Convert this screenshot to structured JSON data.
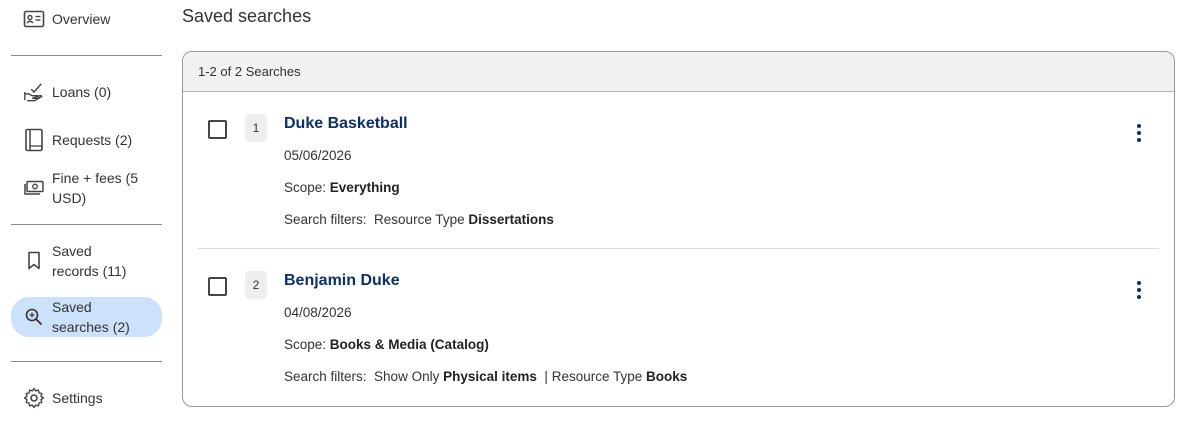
{
  "sidebar": {
    "items": [
      {
        "key": "overview",
        "label": "Overview",
        "icon": "id-card-icon",
        "active": false
      },
      {
        "key": "loans",
        "label": "Loans (0)",
        "icon": "hand-check-icon",
        "active": false
      },
      {
        "key": "requests",
        "label": "Requests (2)",
        "icon": "book-icon",
        "active": false
      },
      {
        "key": "fines",
        "label": "Fine + fees (5 USD)",
        "icon": "money-icon",
        "active": false
      },
      {
        "key": "saved-records",
        "label": "Saved records (11)",
        "icon": "bookmark-icon",
        "active": false
      },
      {
        "key": "saved-searches",
        "label": "Saved searches (2)",
        "icon": "search-magnify-icon",
        "active": true
      },
      {
        "key": "settings",
        "label": "Settings",
        "icon": "gear-icon",
        "active": false
      }
    ],
    "active_color": "#cce1fa"
  },
  "page": {
    "title": "Saved searches"
  },
  "results": {
    "summary": "1-2 of 2 Searches",
    "items": [
      {
        "number": "1",
        "title": "Duke Basketball",
        "date": "05/06/2026",
        "scope_label": "Scope:",
        "scope_value": "Everything",
        "filters_label": "Search filters:",
        "filters": [
          {
            "name": "Resource Type",
            "value": "Dissertations"
          }
        ]
      },
      {
        "number": "2",
        "title": "Benjamin Duke",
        "date": "04/08/2026",
        "scope_label": "Scope:",
        "scope_value": "Books & Media (Catalog)",
        "filters_label": "Search filters:",
        "filters": [
          {
            "name": "Show Only",
            "value": "Physical items"
          },
          {
            "name": "Resource Type",
            "value": "Books"
          }
        ],
        "filter_separator": "|"
      }
    ]
  },
  "colors": {
    "link": "#0d2f6b",
    "header_bg": "#f1f1f1",
    "panel_border": "#999999"
  }
}
